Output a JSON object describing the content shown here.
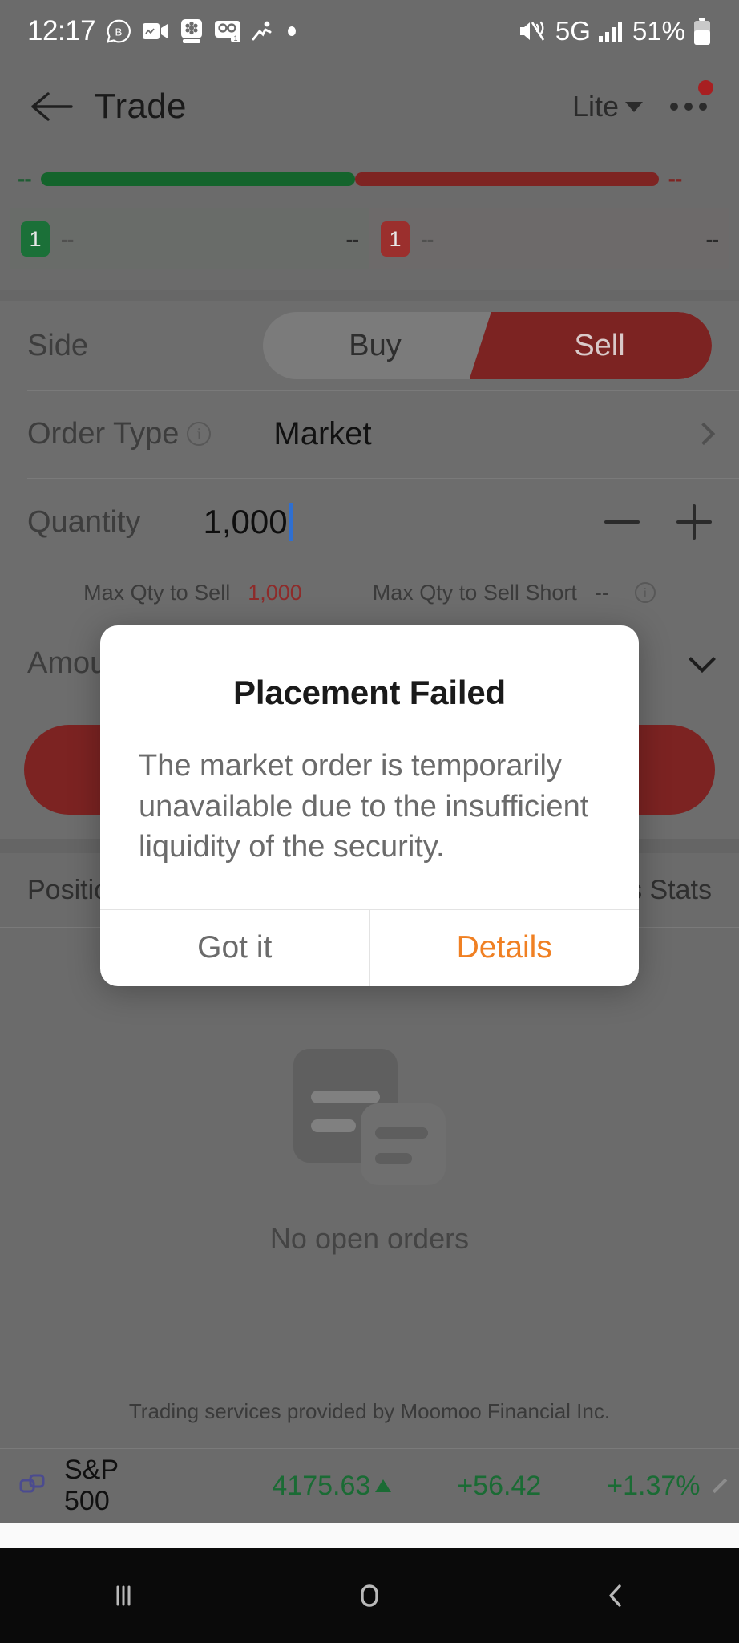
{
  "status_bar": {
    "time": "12:17",
    "battery_percent": "51%",
    "network": "5G",
    "icons": [
      "messenger-b-icon",
      "video-recorder-icon",
      "photo-editor-icon",
      "voicemail-icon",
      "running-person-icon",
      "dot-icon",
      "mute-vibrate-icon",
      "signal-bars-icon",
      "battery-icon"
    ]
  },
  "header": {
    "title": "Trade",
    "mode_label": "Lite",
    "back_icon": "back-arrow-icon",
    "more_icon": "kebab-menu-icon"
  },
  "depth": {
    "bid_dash": "--",
    "ask_dash": "--",
    "bid_level": "1",
    "ask_level": "1",
    "bid_price": "--",
    "bid_qty": "--",
    "ask_price": "--",
    "ask_qty": "--",
    "bid_bar_pct": 51,
    "ask_bar_pct": 49
  },
  "form": {
    "side": {
      "label": "Side",
      "options": [
        "Buy",
        "Sell"
      ],
      "selected": "Sell"
    },
    "order_type": {
      "label": "Order Type",
      "value": "Market",
      "info_icon": "info-icon",
      "chevron_icon": "chevron-right-icon"
    },
    "quantity": {
      "label": "Quantity",
      "value": "1,000",
      "minus_icon": "minus-icon",
      "plus_icon": "plus-icon"
    },
    "hints": {
      "max_qty_to_sell_label": "Max Qty to Sell",
      "max_qty_to_sell_value": "1,000",
      "max_qty_short_label": "Max Qty to Sell Short",
      "max_qty_short_value": "--",
      "info_icon": "info-icon"
    },
    "amount": {
      "label": "Amount",
      "chevron_icon": "chevron-down-icon"
    }
  },
  "tabs": {
    "left": "Positions",
    "right": "Today's Stats"
  },
  "empty_state": {
    "text": "No open orders",
    "art_icon": "empty-orders-illustration"
  },
  "footer": {
    "disclaimer": "Trading services provided by Moomoo Financial Inc."
  },
  "ticker": {
    "link_icon": "link-icon",
    "name": "S&P 500",
    "price": "4175.63",
    "direction_icon": "arrow-up-icon",
    "change": "+56.42",
    "change_percent": "+1.37%",
    "collapse_icon": "chevron-up-icon"
  },
  "modal": {
    "title": "Placement Failed",
    "message": "The market order is temporarily unavailable due to the insufficient liquidity of the security.",
    "primary_button": "Got it",
    "secondary_button": "Details"
  },
  "navbar": {
    "recents_icon": "recents-icon",
    "home_icon": "home-icon",
    "back_icon": "nav-back-icon"
  },
  "colors": {
    "accent_orange": "#f08023",
    "sell_red": "#7c2322",
    "buy_green": "#14642c",
    "up_green": "#1a6b34"
  }
}
